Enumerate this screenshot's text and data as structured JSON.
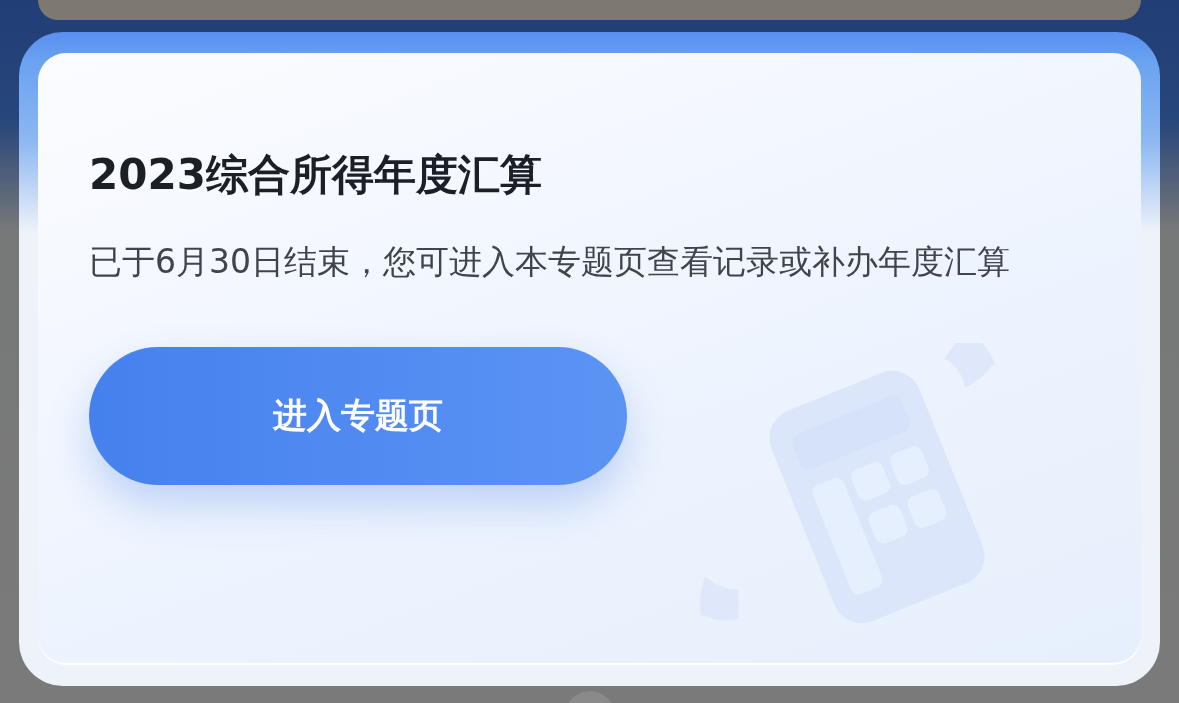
{
  "card": {
    "title": "2023综合所得年度汇算",
    "description": "已于6月30日结束，您可进入本专题页查看记录或补办年度汇算",
    "button": {
      "label": "进入专题页"
    }
  }
}
